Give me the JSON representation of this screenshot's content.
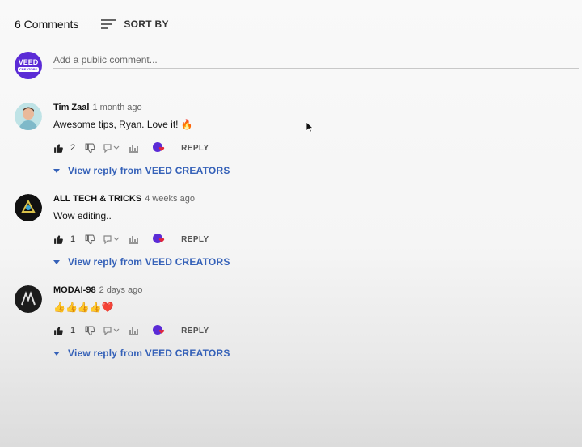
{
  "header": {
    "comment_count": "6 Comments",
    "sort_label": "SORT BY"
  },
  "add_comment": {
    "avatar_text": "VEED",
    "avatar_subtext": "CREATORS",
    "placeholder": "Add a public comment..."
  },
  "comments": [
    {
      "author": "Tim Zaal",
      "time": "1 month ago",
      "text": "Awesome tips, Ryan. Love it! 🔥",
      "likes": "2",
      "reply_label": "REPLY",
      "view_replies": "View reply from VEED CREATORS"
    },
    {
      "author": "ALL TECH & TRICKS",
      "time": "4 weeks ago",
      "text": "Wow editing..",
      "likes": "1",
      "reply_label": "REPLY",
      "view_replies": "View reply from VEED CREATORS"
    },
    {
      "author": "MODAI-98",
      "time": "2 days ago",
      "text": "👍👍👍👍❤️",
      "likes": "1",
      "reply_label": "REPLY",
      "view_replies": "View reply from VEED CREATORS"
    }
  ],
  "colors": {
    "link_blue": "#3561b8",
    "veed_purple": "#5b2bd6",
    "heart_red": "#e0263c"
  }
}
